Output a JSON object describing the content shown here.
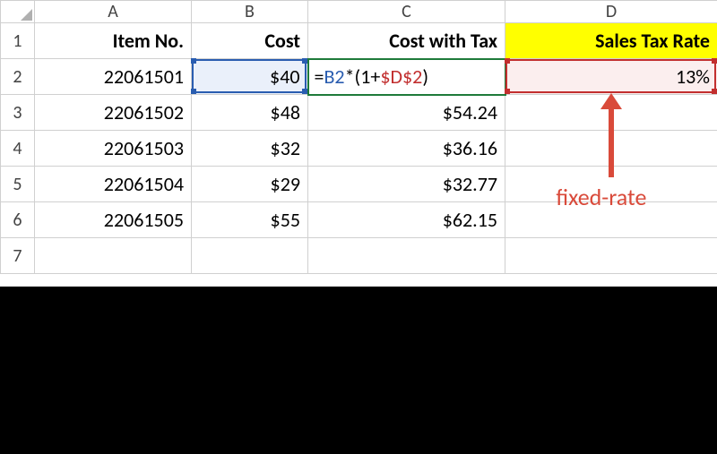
{
  "columns": {
    "A": "A",
    "B": "B",
    "C": "C",
    "D": "D"
  },
  "row_labels": [
    "1",
    "2",
    "3",
    "4",
    "5",
    "6",
    "7"
  ],
  "headers": {
    "A": "Item No.",
    "B": "Cost",
    "C": "Cost with Tax",
    "D": "Sales Tax Rate"
  },
  "formula": {
    "eq": "=",
    "b2": "B2",
    "op1": "*(1+",
    "d2": "$D$2",
    "op2": ")"
  },
  "rows": [
    {
      "item": "22061501",
      "cost": "$40",
      "cwt_is_formula": true,
      "d": "13%"
    },
    {
      "item": "22061502",
      "cost": "$48",
      "cwt": "$54.24",
      "d": ""
    },
    {
      "item": "22061503",
      "cost": "$32",
      "cwt": "$36.16",
      "d": ""
    },
    {
      "item": "22061504",
      "cost": "$29",
      "cwt": "$32.77",
      "d": ""
    },
    {
      "item": "22061505",
      "cost": "$55",
      "cwt": "$62.15",
      "d": ""
    }
  ],
  "annotation": "fixed-rate",
  "chart_data": {
    "type": "table",
    "note": "Excel worksheet showing formula =B2*(1+$D$2) in C2; D2 is absolute reference (fixed-rate 13%).",
    "headers": [
      "Item No.",
      "Cost",
      "Cost with Tax",
      "Sales Tax Rate"
    ],
    "rows": [
      [
        "22061501",
        40,
        "=B2*(1+$D$2)",
        "13%"
      ],
      [
        "22061502",
        48,
        54.24,
        ""
      ],
      [
        "22061503",
        32,
        36.16,
        ""
      ],
      [
        "22061504",
        29,
        32.77,
        ""
      ],
      [
        "22061505",
        55,
        62.15,
        ""
      ]
    ],
    "sales_tax_rate": 0.13
  }
}
